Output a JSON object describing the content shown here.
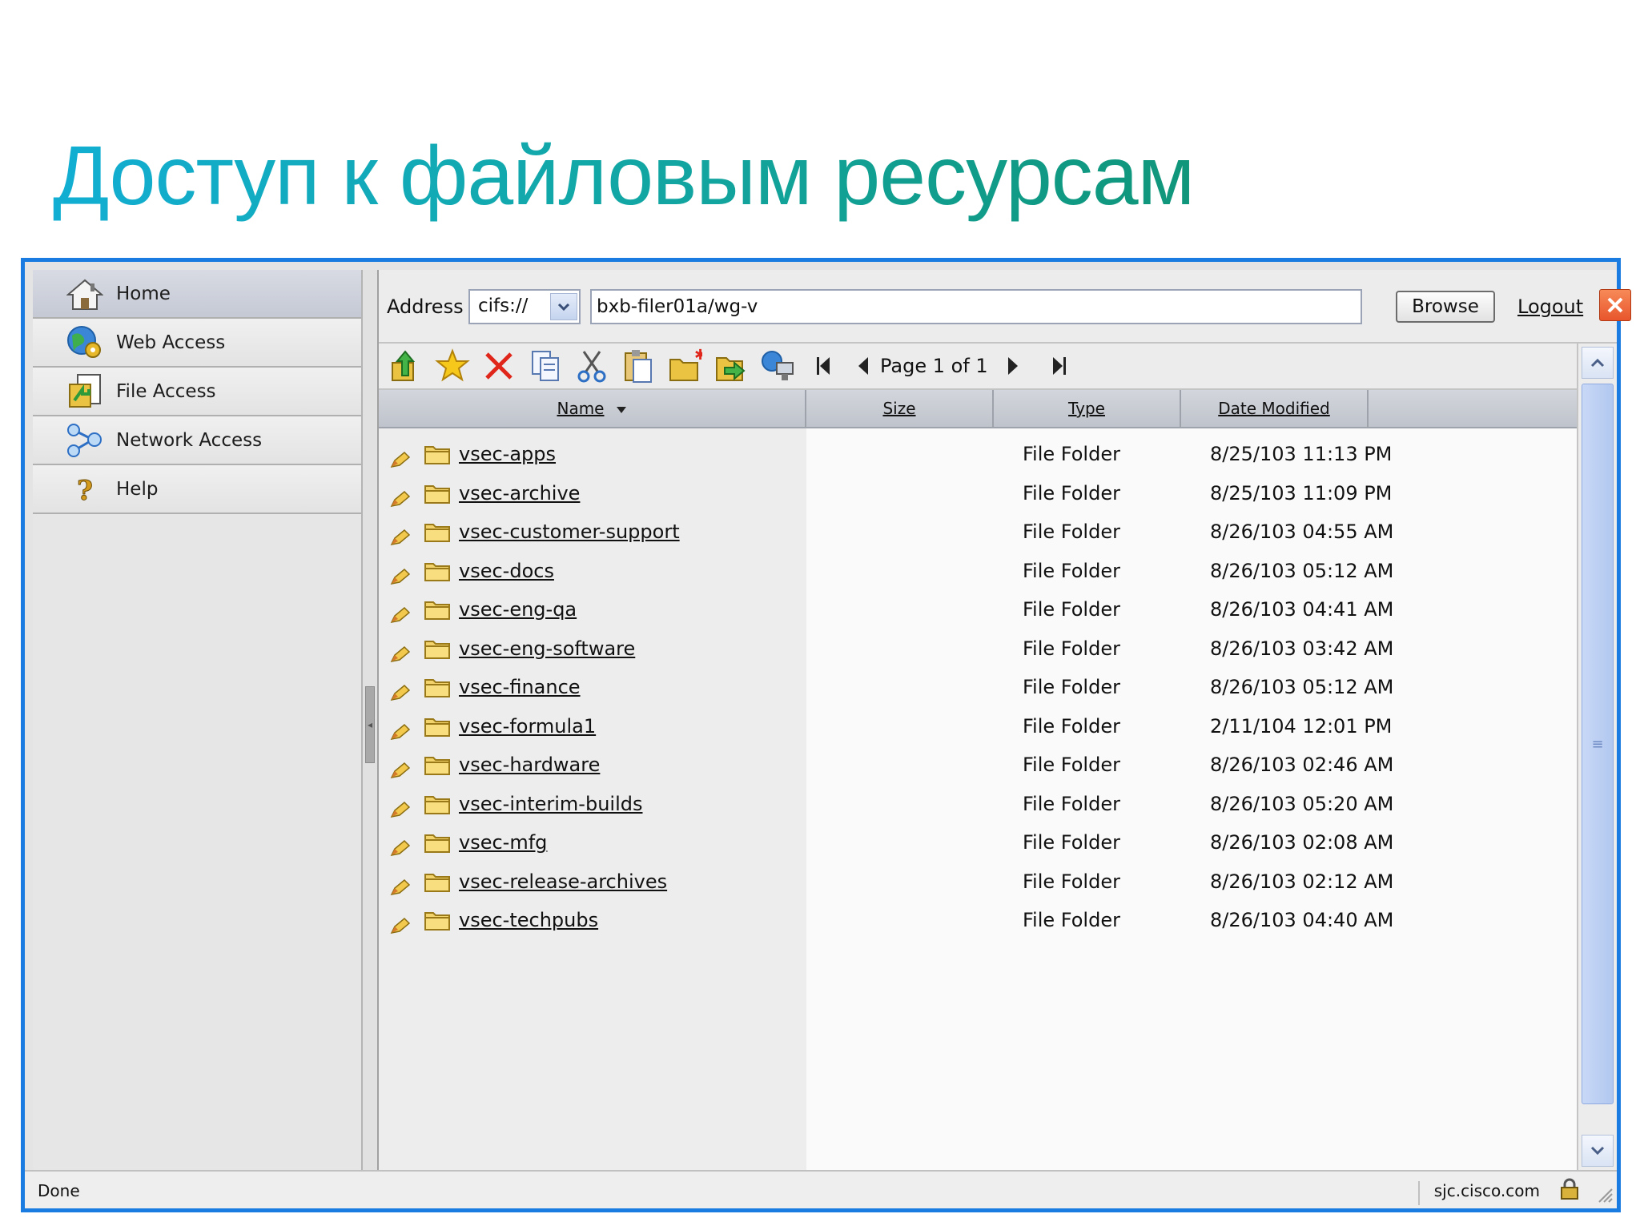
{
  "slide": {
    "title": "Доступ к файловым ресурсам"
  },
  "sidebar": {
    "items": [
      {
        "label": "Home",
        "icon": "home-icon"
      },
      {
        "label": "Web Access",
        "icon": "globe-gear-icon"
      },
      {
        "label": "File Access",
        "icon": "file-access-icon"
      },
      {
        "label": "Network Access",
        "icon": "network-icon"
      },
      {
        "label": "Help",
        "icon": "help-icon"
      }
    ]
  },
  "addressbar": {
    "label": "Address",
    "protocol": "cifs://",
    "path": "bxb-filer01a/wg-v",
    "browse_label": "Browse",
    "logout_label": "Logout"
  },
  "toolbar": {
    "page_label": "Page 1 of 1",
    "icons": [
      "up-folder-icon",
      "favorite-star-icon",
      "delete-icon",
      "copy-icon",
      "cut-icon",
      "paste-icon",
      "new-folder-icon",
      "move-icon",
      "network-drive-icon"
    ]
  },
  "table": {
    "columns": [
      "Name",
      "Size",
      "Type",
      "Date Modified"
    ],
    "rows": [
      {
        "name": "vsec-apps",
        "type": "File Folder",
        "date": "8/25/103 11:13 PM"
      },
      {
        "name": "vsec-archive",
        "type": "File Folder",
        "date": "8/25/103 11:09 PM"
      },
      {
        "name": "vsec-customer-support",
        "type": "File Folder",
        "date": "8/26/103 04:55 AM"
      },
      {
        "name": "vsec-docs",
        "type": "File Folder",
        "date": "8/26/103 05:12 AM"
      },
      {
        "name": "vsec-eng-qa",
        "type": "File Folder",
        "date": "8/26/103 04:41 AM"
      },
      {
        "name": "vsec-eng-software",
        "type": "File Folder",
        "date": "8/26/103 03:42 AM"
      },
      {
        "name": "vsec-finance",
        "type": "File Folder",
        "date": "8/26/103 05:12 AM"
      },
      {
        "name": "vsec-formula1",
        "type": "File Folder",
        "date": "2/11/104 12:01 PM"
      },
      {
        "name": "vsec-hardware",
        "type": "File Folder",
        "date": "8/26/103 02:46 AM"
      },
      {
        "name": "vsec-interim-builds",
        "type": "File Folder",
        "date": "8/26/103 05:20 AM"
      },
      {
        "name": "vsec-mfg",
        "type": "File Folder",
        "date": "8/26/103 02:08 AM"
      },
      {
        "name": "vsec-release-archives",
        "type": "File Folder",
        "date": "8/26/103 02:12 AM"
      },
      {
        "name": "vsec-techpubs",
        "type": "File Folder",
        "date": "8/26/103 04:40 AM"
      }
    ]
  },
  "status": {
    "text": "Done",
    "host": "sjc.cisco.com"
  },
  "colors": {
    "title_start": "#12aed3",
    "title_end": "#10967a",
    "window_border": "#1a7be0",
    "close": "#e8552c"
  }
}
